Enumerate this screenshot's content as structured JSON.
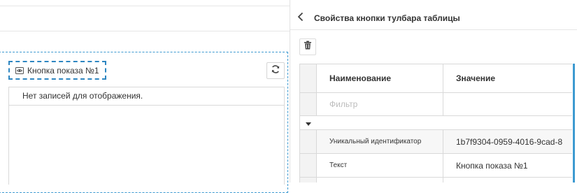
{
  "designer": {
    "toolbar_button": {
      "label": "Кнопка показа №1",
      "icon": "eye-icon"
    },
    "refresh_icon": "refresh-icon",
    "grid": {
      "empty_text": "Нет записей для отображения."
    }
  },
  "panel": {
    "title": "Свойства кнопки тулбара таблицы",
    "back_icon": "chevron-left-icon",
    "delete_icon": "trash-icon",
    "table": {
      "columns": [
        "Наименование",
        "Значение"
      ],
      "filter_placeholder": "Фильтр",
      "rows": [
        {
          "name": "Уникальный идентификатор",
          "value": "1b7f9304-0959-4016-9cad-8"
        },
        {
          "name": "Текст",
          "value": "Кнопка показа №1"
        }
      ]
    }
  },
  "colors": {
    "accent": "#3d9ad1",
    "selection_border": "#2e86c1"
  }
}
